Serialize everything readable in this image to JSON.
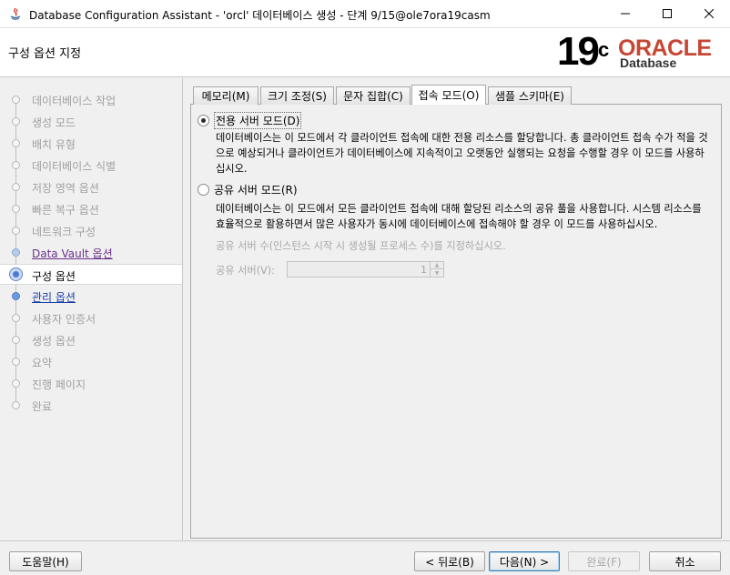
{
  "window": {
    "title": "Database Configuration Assistant - 'orcl' 데이터베이스 생성 - 단계 9/15@ole7ora19casm"
  },
  "header": {
    "page_title": "구성 옵션 지정",
    "logo_version": "19",
    "logo_version_suffix": "c",
    "logo_brand": "ORACLE",
    "logo_product": "Database",
    "brand_color": "#c74634"
  },
  "sidebar": {
    "steps": [
      {
        "label": "데이터베이스 작업",
        "state": "disabled"
      },
      {
        "label": "생성 모드",
        "state": "disabled"
      },
      {
        "label": "배치 유형",
        "state": "disabled"
      },
      {
        "label": "데이터베이스 식별",
        "state": "disabled"
      },
      {
        "label": "저장 영역 옵션",
        "state": "disabled"
      },
      {
        "label": "빠른 복구 옵션",
        "state": "disabled"
      },
      {
        "label": "네트워크 구성",
        "state": "disabled"
      },
      {
        "label": "Data Vault 옵션",
        "state": "visited"
      },
      {
        "label": "구성 옵션",
        "state": "current"
      },
      {
        "label": "관리 옵션",
        "state": "link"
      },
      {
        "label": "사용자 인증서",
        "state": "disabled"
      },
      {
        "label": "생성 옵션",
        "state": "disabled"
      },
      {
        "label": "요약",
        "state": "disabled"
      },
      {
        "label": "진행 페이지",
        "state": "disabled"
      },
      {
        "label": "완료",
        "state": "disabled"
      }
    ]
  },
  "tabs": [
    {
      "label": "메모리(M)",
      "active": false
    },
    {
      "label": "크기 조정(S)",
      "active": false
    },
    {
      "label": "문자 집합(C)",
      "active": false
    },
    {
      "label": "접속 모드(O)",
      "active": true
    },
    {
      "label": "샘플 스키마(E)",
      "active": false
    }
  ],
  "connection_mode": {
    "dedicated": {
      "label": "전용 서버 모드(D)",
      "checked": true,
      "description": "데이터베이스는 이 모드에서 각 클라이언트 접속에 대한 전용 리소스를 할당합니다. 총 클라이언트 접속 수가 적을 것으로 예상되거나 클라이언트가 데이터베이스에 지속적이고 오랫동안 실행되는 요청을 수행할 경우 이 모드를 사용하십시오."
    },
    "shared": {
      "label": "공유 서버 모드(R)",
      "checked": false,
      "description": "데이터베이스는 이 모드에서 모든 클라이언트 접속에 대해 할당된 리소스의 공유 풀을 사용합니다. 시스템 리소스를 효율적으로 활용하면서 많은 사용자가 동시에 데이터베이스에 접속해야 할 경우 이 모드를 사용하십시오.",
      "server_count_hint": "공유 서버 수(인스턴스 시작 시 생성될 프로세스 수)를 지정하십시오.",
      "server_count_label": "공유 서버(V):",
      "server_count_value": "1"
    }
  },
  "footer": {
    "help": "도움말(H)",
    "back": "< 뒤로(B)",
    "next": "다음(N) >",
    "finish": "완료(F)",
    "cancel": "취소"
  }
}
